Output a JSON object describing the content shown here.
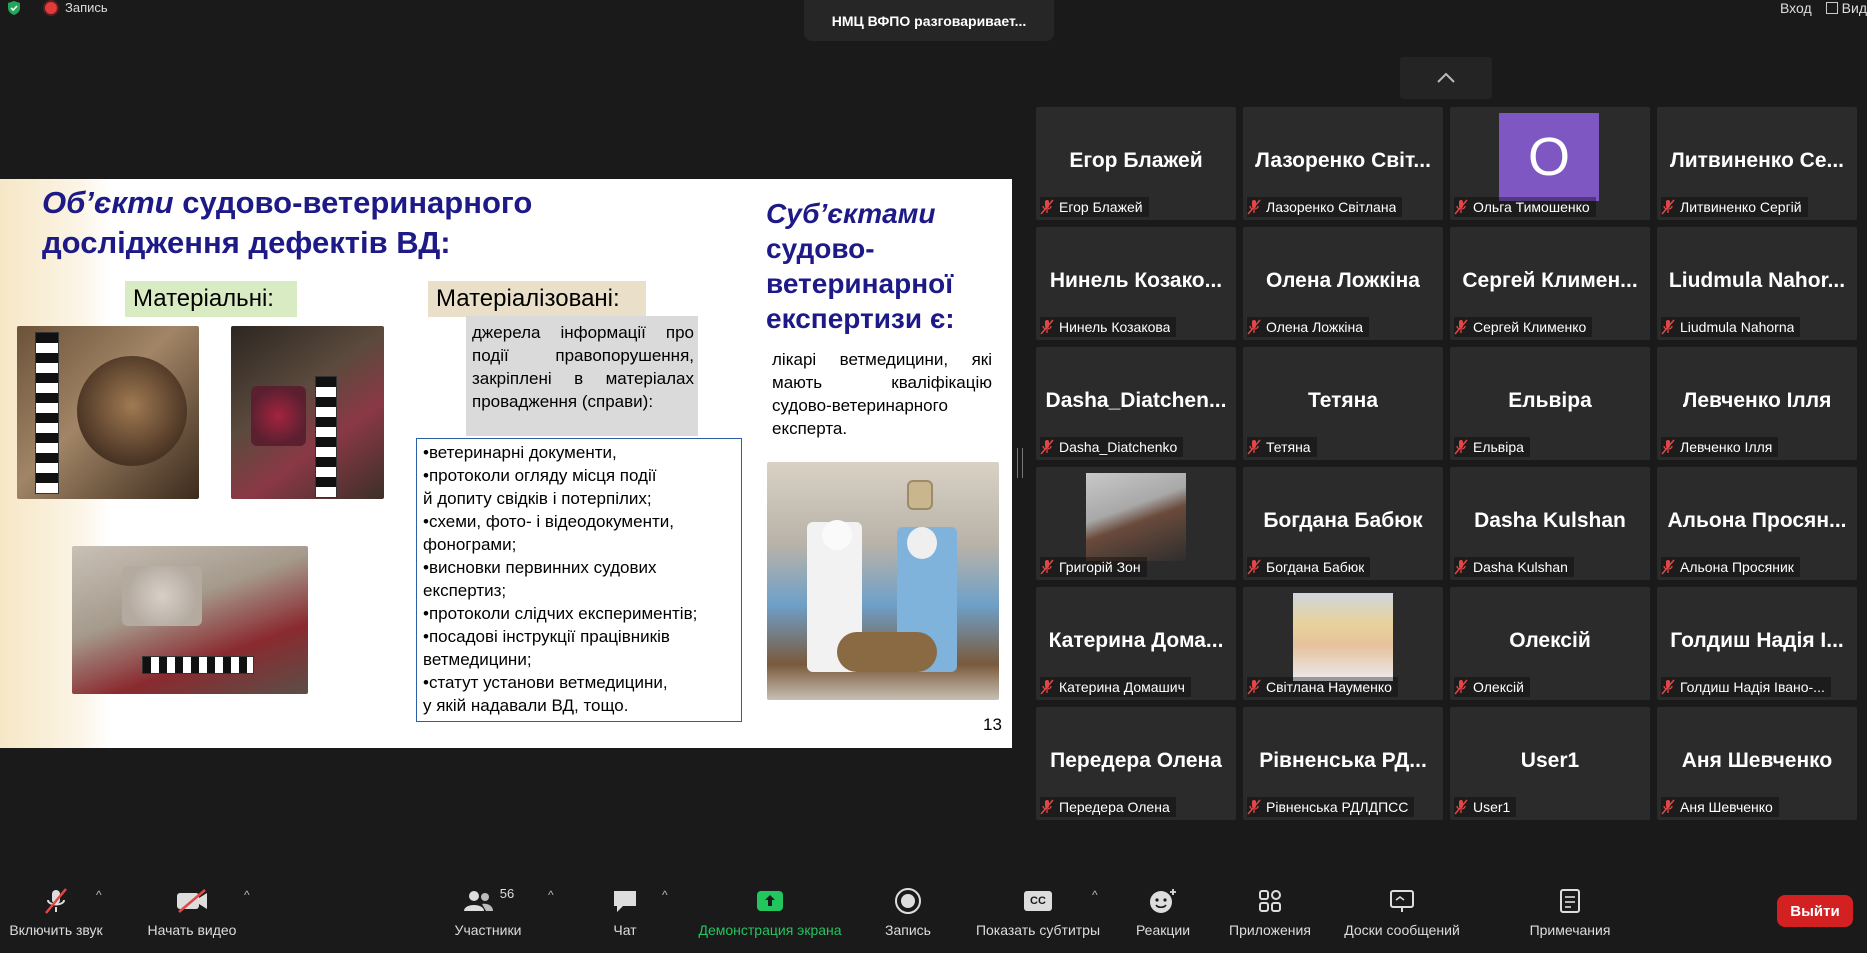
{
  "top": {
    "recording_label": "Запись",
    "speaker_banner": "НМЦ ВФПО разговаривает...",
    "enter_label": "Вход",
    "view_label": "Вид"
  },
  "slide": {
    "title_italic": "Об’єкти",
    "title_rest": " судово-ветеринарного дослідження дефектів ВД:",
    "tag_material": "Матеріальні:",
    "tag_materialized": "Матеріалізовані:",
    "grey_text": "джерела інформації про події правопорушення, закріплені в матеріалах провадження (справи):",
    "list_text": "•ветеринарні документи,\n•протоколи огляду місця події\nй допиту свідків і потерпілих;\n•схеми, фото- і відеодокументи,\nфонограми;\n•висновки первинних судових\nекспертиз;\n•протоколи слідчих експериментів;\n•посадові інструкції працівників\nветмедицини;\n•статут установи ветмедицини,\nу якій надавали ВД, тощо.",
    "subject_italic": "Суб’єктами",
    "subject_rest": " судово-ветеринарної експертизи є:",
    "subject_text": "лікарі ветмедицини, які мають кваліфікацію судово-ветеринарного експерта.",
    "page_number": "13"
  },
  "participants": [
    {
      "display": "Егор Блажей",
      "label": "Егор Блажей",
      "kind": "name"
    },
    {
      "display": "Лазоренко Світ...",
      "label": "Лазоренко Світлана",
      "kind": "name"
    },
    {
      "display": "О",
      "label": "Ольга Тимошенко",
      "kind": "avatar"
    },
    {
      "display": "Литвиненко Се...",
      "label": "Литвиненко Сергій",
      "kind": "name"
    },
    {
      "display": "Нинель Козако...",
      "label": "Нинель Козакова",
      "kind": "name"
    },
    {
      "display": "Олена Ложкіна",
      "label": "Олена Ложкіна",
      "kind": "name"
    },
    {
      "display": "Сергей Климен...",
      "label": "Сергей Клименко",
      "kind": "name"
    },
    {
      "display": "Liudmula Nahor...",
      "label": "Liudmula Nahorna",
      "kind": "name"
    },
    {
      "display": "Dasha_Diatchen...",
      "label": "Dasha_Diatchenko",
      "kind": "name"
    },
    {
      "display": "Тетяна",
      "label": "Тетяна",
      "kind": "name"
    },
    {
      "display": "Ельвіра",
      "label": "Ельвіра",
      "kind": "name"
    },
    {
      "display": "Левченко Ілля",
      "label": "Левченко Ілля",
      "kind": "name"
    },
    {
      "display": "",
      "label": "Григорій Зон",
      "kind": "video-man"
    },
    {
      "display": "Богдана Бабюк",
      "label": "Богдана Бабюк",
      "kind": "name"
    },
    {
      "display": "Dasha Kulshan",
      "label": "Dasha Kulshan",
      "kind": "name"
    },
    {
      "display": "Альона Просян...",
      "label": "Альона Просяник",
      "kind": "name"
    },
    {
      "display": "Катерина Дома...",
      "label": "Катерина Домашич",
      "kind": "name"
    },
    {
      "display": "",
      "label": "Світлана Науменко",
      "kind": "video-woman"
    },
    {
      "display": "Олексій",
      "label": "Олексій",
      "kind": "name"
    },
    {
      "display": "Голдиш Надія І...",
      "label": "Голдиш Надія Івано-...",
      "kind": "name"
    },
    {
      "display": "Передера Олена",
      "label": "Передера Олена",
      "kind": "name"
    },
    {
      "display": "Рівненська РД...",
      "label": "Рівненська РДЛДПСС",
      "kind": "name"
    },
    {
      "display": "User1",
      "label": "User1",
      "kind": "name"
    },
    {
      "display": "Аня Шевченко",
      "label": "Аня Шевченко",
      "kind": "name"
    }
  ],
  "toolbar": {
    "unmute_label": "Включить звук",
    "start_video_label": "Начать видео",
    "participants_label": "Участники",
    "participants_count": "56",
    "chat_label": "Чат",
    "share_label": "Демонстрация экрана",
    "record_label": "Запись",
    "captions_label": "Показать субтитры",
    "captions_badge": "CC",
    "reactions_label": "Реакции",
    "apps_label": "Приложения",
    "whiteboards_label": "Доски сообщений",
    "notes_label": "Примечания",
    "leave_label": "Выйти"
  },
  "colors": {
    "accent_green": "#22c55e",
    "leave_red": "#d32020",
    "mic_off_red": "#e04848",
    "slide_title_blue": "#1d1a87"
  }
}
